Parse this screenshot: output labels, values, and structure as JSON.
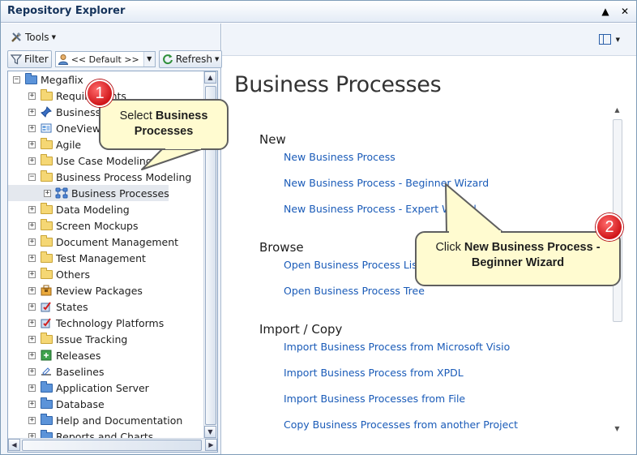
{
  "window": {
    "title": "Repository Explorer"
  },
  "toolbar": {
    "tools_label": "Tools",
    "filter_label": "Filter",
    "filter_value": "<< Default >>",
    "refresh_label": "Refresh"
  },
  "tree": {
    "root": "Megaflix",
    "items": [
      {
        "label": "Requirements",
        "icon": "folder-icon"
      },
      {
        "label": "Business",
        "icon": "pin-icon"
      },
      {
        "label": "OneView",
        "icon": "oneview-icon"
      },
      {
        "label": "Agile",
        "icon": "folder-icon"
      },
      {
        "label": "Use Case Modeling",
        "icon": "folder-icon"
      },
      {
        "label": "Business Process Modeling",
        "icon": "folder-icon"
      },
      {
        "label": "Business Processes",
        "icon": "business-process-icon"
      },
      {
        "label": "Data Modeling",
        "icon": "folder-icon"
      },
      {
        "label": "Screen Mockups",
        "icon": "folder-icon"
      },
      {
        "label": "Document Management",
        "icon": "folder-icon"
      },
      {
        "label": "Test Management",
        "icon": "folder-icon"
      },
      {
        "label": "Others",
        "icon": "folder-icon"
      },
      {
        "label": "Review Packages",
        "icon": "package-icon"
      },
      {
        "label": "States",
        "icon": "states-icon"
      },
      {
        "label": "Technology Platforms",
        "icon": "platforms-icon"
      },
      {
        "label": "Issue Tracking",
        "icon": "folder-icon"
      },
      {
        "label": "Releases",
        "icon": "releases-icon"
      },
      {
        "label": "Baselines",
        "icon": "baselines-icon"
      },
      {
        "label": "Application Server",
        "icon": "folder-blue-icon"
      },
      {
        "label": "Database",
        "icon": "folder-blue-icon"
      },
      {
        "label": "Help and Documentation",
        "icon": "folder-blue-icon"
      },
      {
        "label": "Reports and Charts",
        "icon": "folder-blue-icon"
      }
    ]
  },
  "main": {
    "title": "Business Processes",
    "sections": [
      {
        "heading": "New",
        "links": [
          "New Business Process",
          "New Business Process - Beginner Wizard",
          "New Business Process - Expert Wizard"
        ]
      },
      {
        "heading": "Browse",
        "links": [
          "Open Business Process List",
          "Open Business Process Tree"
        ]
      },
      {
        "heading": "Import / Copy",
        "links": [
          "Import Business Process from Microsoft Visio",
          "Import Business Process from XPDL",
          "Import Business Processes from File",
          "Copy Business Processes from another Project"
        ]
      }
    ]
  },
  "callouts": {
    "one": {
      "number": "1",
      "prefix": "Select ",
      "bold": "Business Processes"
    },
    "two": {
      "number": "2",
      "prefix": "Click ",
      "bold": "New Business Process - Beginner Wizard"
    }
  },
  "colors": {
    "link": "#1a5bb8",
    "callout_fill": "#fffbd0",
    "badge": "#d0161a",
    "folder": "#f5d774"
  }
}
